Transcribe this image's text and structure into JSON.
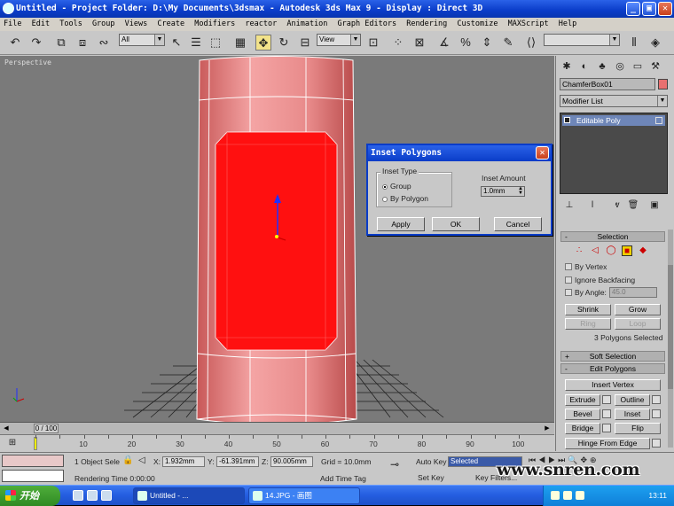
{
  "titlebar": {
    "title": "Untitled     - Project Folder: D:\\My Documents\\3dsmax     - Autodesk 3ds Max 9      - Display : Direct 3D",
    "minimize": "_",
    "maximize": "▣",
    "close": "✕"
  },
  "menu": [
    "File",
    "Edit",
    "Tools",
    "Group",
    "Views",
    "Create",
    "Modifiers",
    "reactor",
    "Animation",
    "Graph Editors",
    "Rendering",
    "Customize",
    "MAXScript",
    "Help"
  ],
  "toolbar": {
    "selection_filter": "All",
    "coord_system": "View"
  },
  "viewport": {
    "label": "Perspective"
  },
  "dialog": {
    "title": "Inset Polygons",
    "inset_type_label": "Inset Type",
    "option_group": "Group",
    "option_by_polygon": "By Polygon",
    "inset_amount_label": "Inset Amount",
    "inset_amount_value": "1.0mm",
    "apply_label": "Apply",
    "ok_label": "OK",
    "cancel_label": "Cancel"
  },
  "panel": {
    "object_name": "ChamferBox01",
    "object_color": "#e87070",
    "modifier_list": "Modifier List",
    "stack_item": "Editable Poly",
    "selection_rollout": "Selection",
    "by_vertex": "By Vertex",
    "ignore_backfacing": "Ignore Backfacing",
    "by_angle": "By Angle:",
    "by_angle_value": "45.0",
    "shrink": "Shrink",
    "grow": "Grow",
    "ring": "Ring",
    "loop": "Loop",
    "selected_status": "3 Polygons Selected",
    "soft_selection": "Soft Selection",
    "edit_polygons": "Edit Polygons",
    "insert_vertex": "Insert Vertex",
    "extrude": "Extrude",
    "outline": "Outline",
    "bevel": "Bevel",
    "inset": "Inset",
    "bridge": "Bridge",
    "flip": "Flip",
    "hinge_from_edge": "Hinge From Edge"
  },
  "timeline": {
    "frame_display": "0 / 100",
    "ticks": [
      "10",
      "20",
      "30",
      "40",
      "50",
      "60",
      "70",
      "80",
      "90",
      "100"
    ]
  },
  "status": {
    "selection": "1 Object Sele",
    "x_label": "X:",
    "x_value": "1.932mm",
    "y_label": "Y:",
    "y_value": "-61.391mm",
    "z_label": "Z:",
    "z_value": "90.005mm",
    "grid": "Grid = 10.0mm",
    "auto_key": "Auto Key",
    "key_mode": "Selected",
    "rendering_time": "Rendering Time  0:00:00",
    "add_time_tag": "Add Time Tag",
    "set_key": "Set Key",
    "key_filters": "Key Filters..."
  },
  "watermark": "www.snren.com",
  "taskbar": {
    "start": "开始",
    "task_max": "Untitled       - ...",
    "task_paint": "14.JPG - 画图",
    "clock": "13:11"
  }
}
